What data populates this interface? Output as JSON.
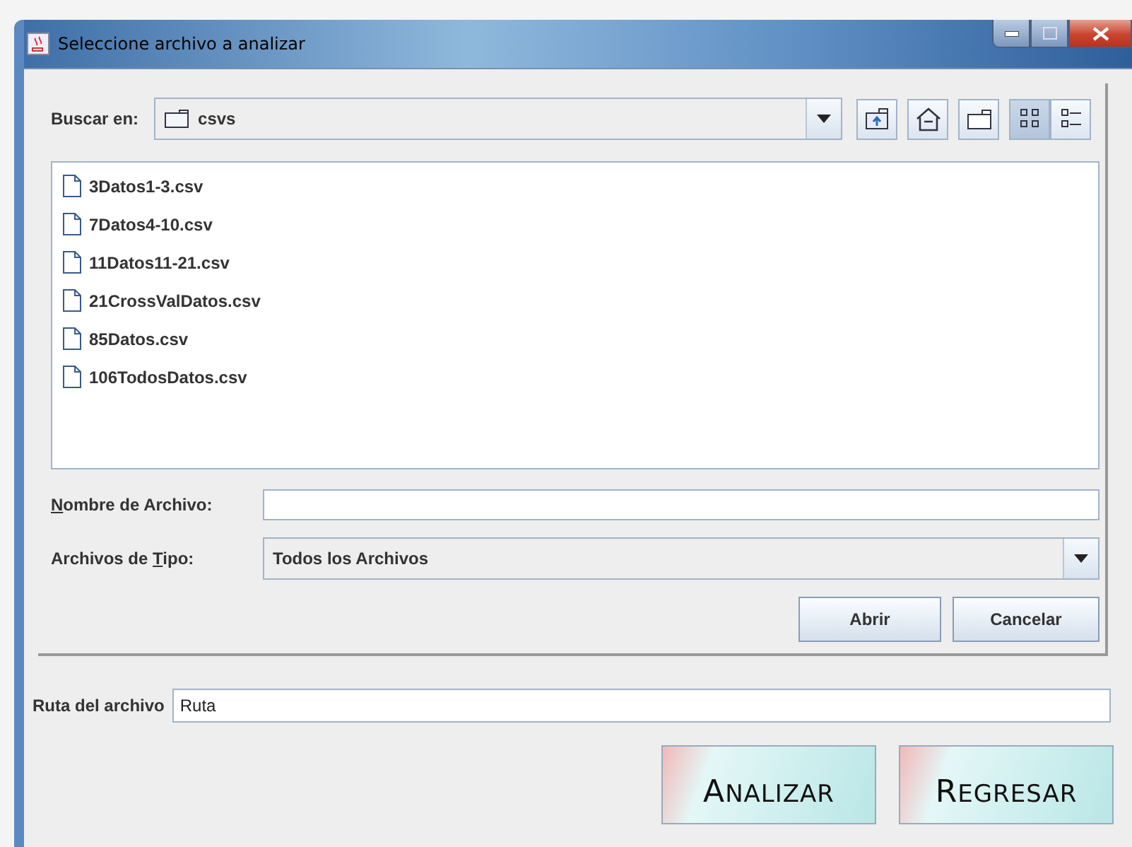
{
  "window": {
    "title": "Seleccione archivo a analizar"
  },
  "chooser": {
    "look_in": {
      "label": "Buscar en:",
      "value": "csvs"
    },
    "toolbar": [
      {
        "kind": "up",
        "selected": false
      },
      {
        "kind": "home",
        "selected": false
      },
      {
        "kind": "newfolder",
        "selected": false
      },
      {
        "kind": "list",
        "selected": true
      },
      {
        "kind": "details",
        "selected": false
      }
    ],
    "files": [
      {
        "name": "3Datos1-3.csv",
        "selected": false
      },
      {
        "name": "7Datos4-10.csv",
        "selected": false
      },
      {
        "name": "11Datos11-21.csv",
        "selected": false
      },
      {
        "name": "21CrossValDatos.csv",
        "selected": false
      },
      {
        "name": "85Datos.csv",
        "selected": false
      },
      {
        "name": "106TodosDatos.csv",
        "selected": false
      }
    ],
    "file_name": {
      "label": [
        {
          "text": "N",
          "underlined": true
        },
        {
          "text": "ombre de Archivo:",
          "underlined": false
        }
      ]
    },
    "file_type": {
      "label": [
        {
          "text": "Archivos de ",
          "underlined": false
        },
        {
          "text": "T",
          "underlined": true
        },
        {
          "text": "ipo:",
          "underlined": false
        }
      ],
      "value": "Todos los Archivos"
    },
    "buttons": [
      "Abrir",
      "Cancelar"
    ]
  },
  "path": {
    "label": "Ruta del archivo",
    "value": "Ruta"
  },
  "actions": [
    "ANALIZAR",
    "REGRESAR"
  ]
}
